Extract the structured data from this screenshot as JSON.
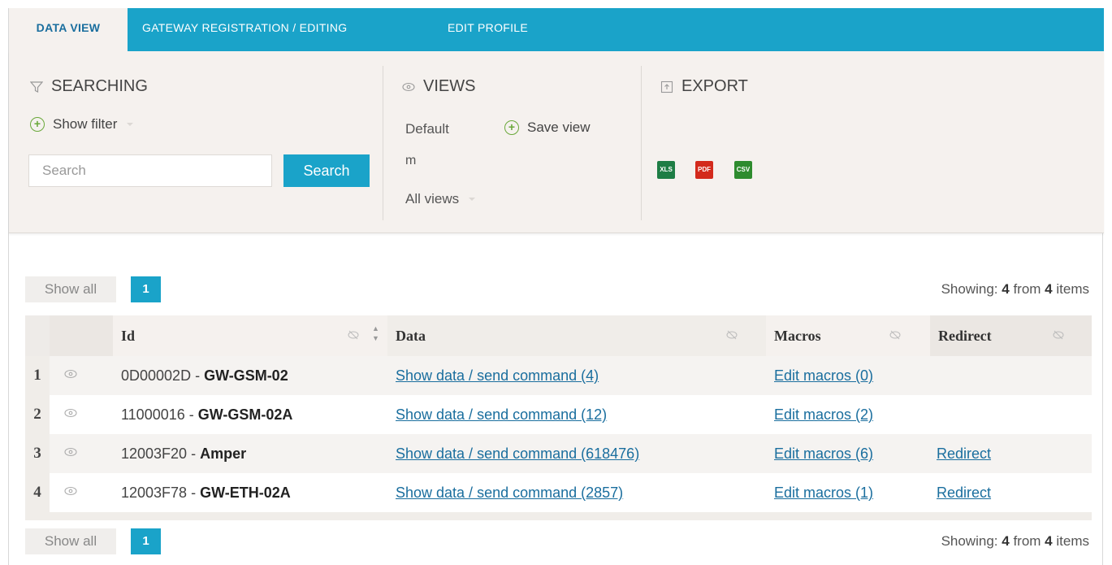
{
  "tabs": [
    {
      "label": "DATA VIEW",
      "active": true
    },
    {
      "label": "GATEWAY REGISTRATION / EDITING",
      "active": false
    },
    {
      "label": "EDIT PROFILE",
      "active": false
    }
  ],
  "searching": {
    "title": "SEARCHING",
    "show_filter": "Show filter",
    "search_placeholder": "Search",
    "search_button": "Search"
  },
  "views": {
    "title": "VIEWS",
    "default": "Default",
    "save_view": "Save view",
    "m": "m",
    "all_views": "All views"
  },
  "export": {
    "title": "EXPORT",
    "xls": "XLS",
    "pdf": "PDF",
    "csv": "CSV"
  },
  "pagination": {
    "show_all": "Show all",
    "page": "1",
    "showing_prefix": "Showing:",
    "showing_count": "4",
    "showing_mid": "from",
    "showing_total": "4",
    "showing_suffix": "items"
  },
  "colors": {
    "accent": "#1aa3c9",
    "link": "#1a6e9e",
    "panel_bg": "#f5f1ee",
    "xls": "#1e7d45",
    "pdf": "#d32a1c",
    "csv": "#2e8b2e"
  },
  "table": {
    "headers": {
      "id": "Id",
      "data": "Data",
      "macros": "Macros",
      "redirect": "Redirect"
    },
    "rows": [
      {
        "num": "1",
        "id_code": "0D00002D",
        "id_sep": " - ",
        "id_name": "GW-GSM-02",
        "data": "Show data / send command (4)",
        "macros": "Edit macros (0)",
        "redirect": ""
      },
      {
        "num": "2",
        "id_code": "11000016",
        "id_sep": " - ",
        "id_name": "GW-GSM-02A",
        "data": "Show data / send command (12)",
        "macros": "Edit macros (2)",
        "redirect": ""
      },
      {
        "num": "3",
        "id_code": "12003F20",
        "id_sep": " - ",
        "id_name": "Amper",
        "data": "Show data / send command (618476)",
        "macros": "Edit macros (6)",
        "redirect": "Redirect"
      },
      {
        "num": "4",
        "id_code": "12003F78",
        "id_sep": " - ",
        "id_name": "GW-ETH-02A",
        "data": "Show data / send command (2857)",
        "macros": "Edit macros (1)",
        "redirect": "Redirect"
      }
    ]
  }
}
